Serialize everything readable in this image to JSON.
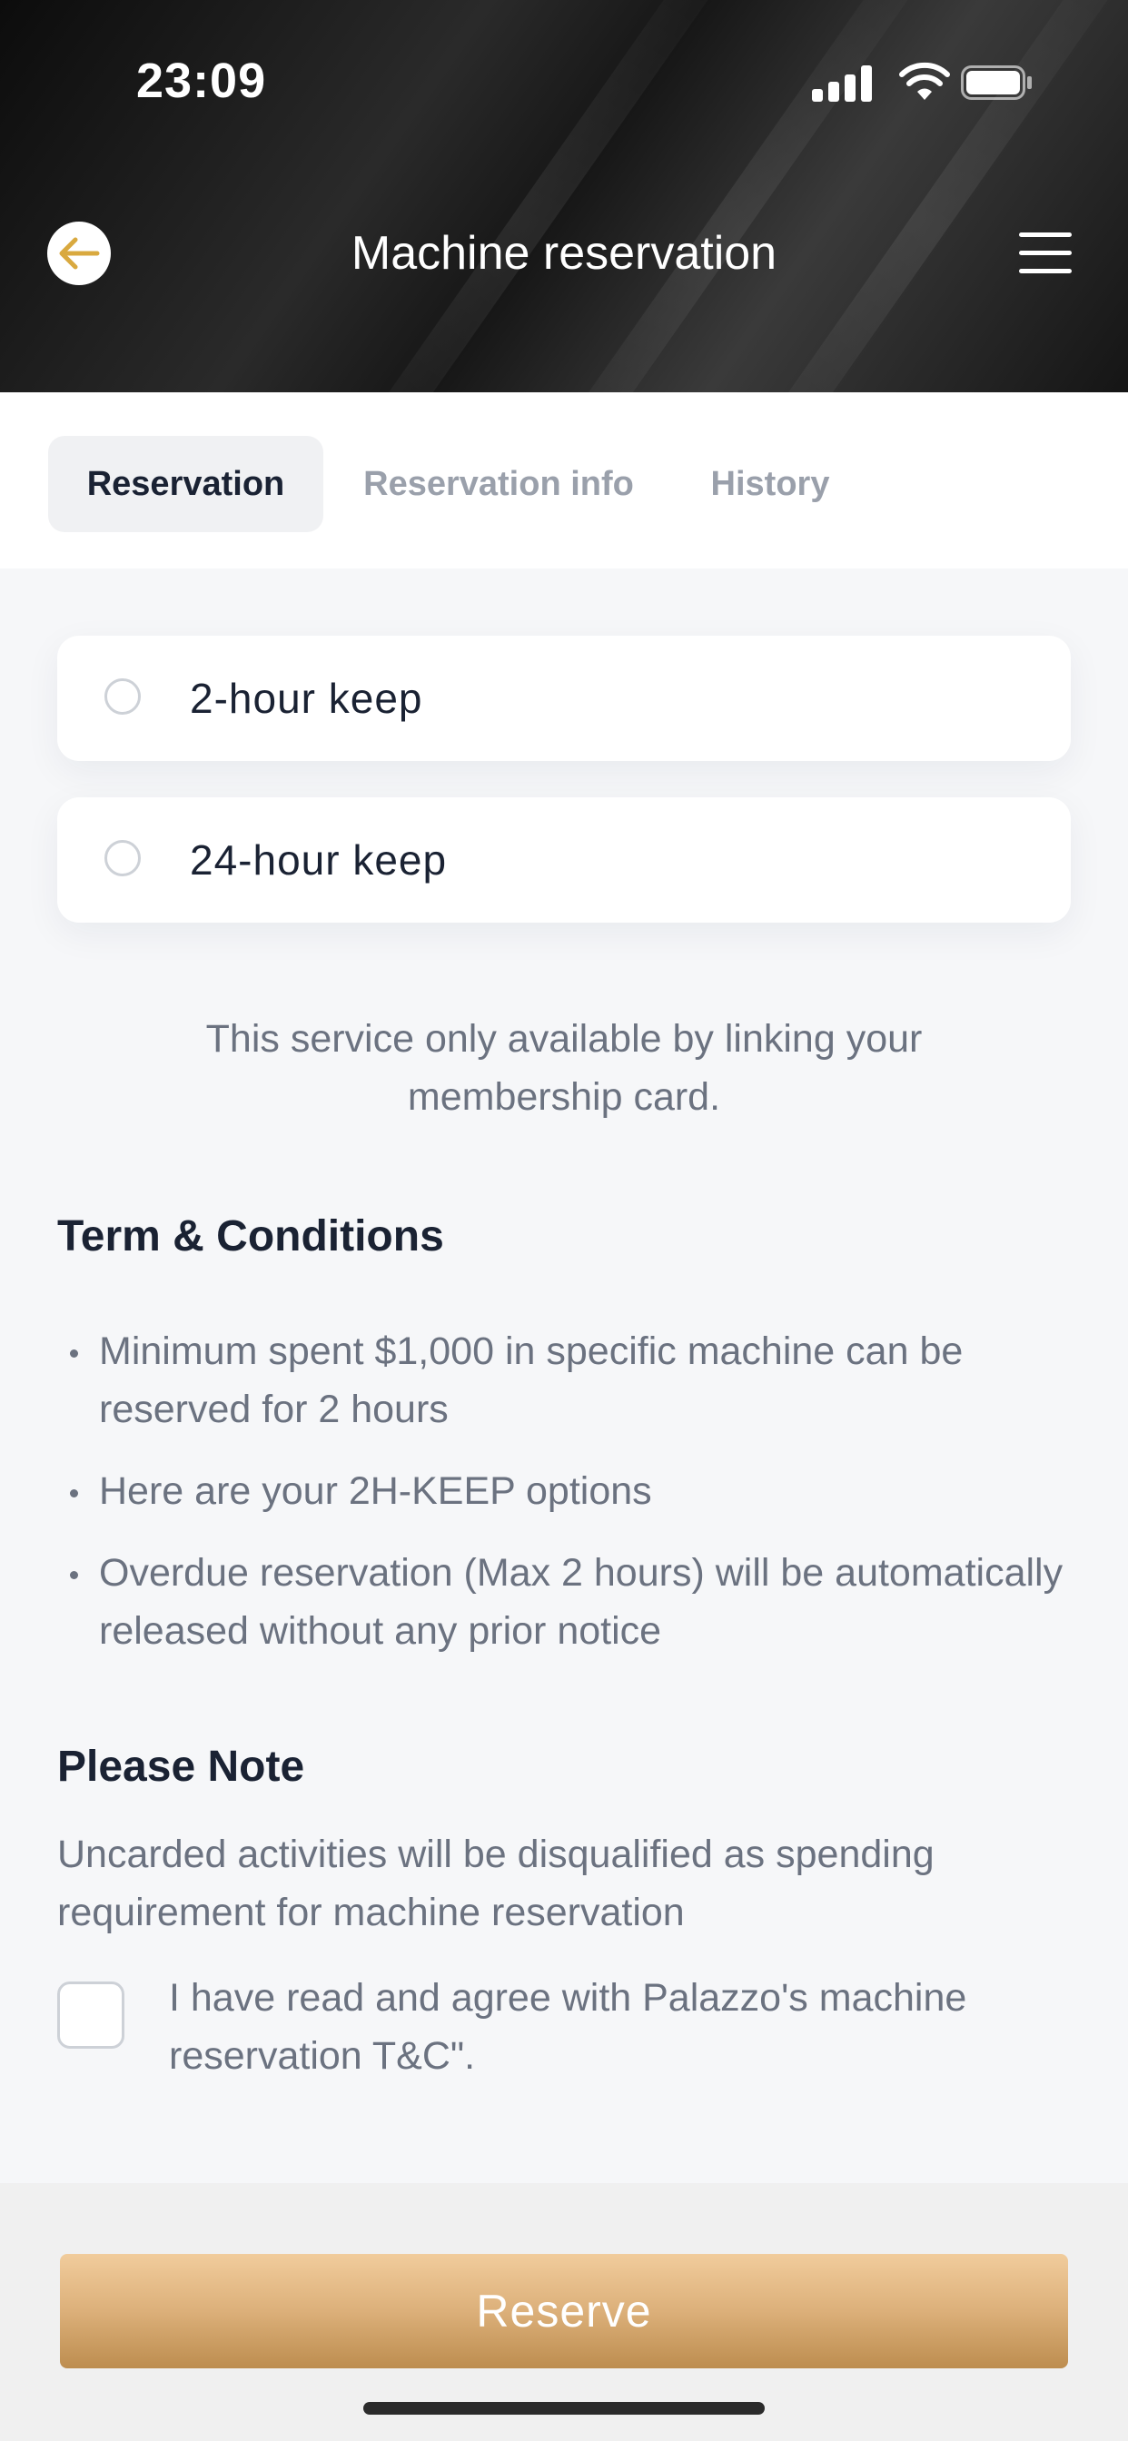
{
  "status_bar": {
    "time": "23:09"
  },
  "header": {
    "title": "Machine reservation",
    "back_icon": "arrow-left-icon",
    "menu_icon": "hamburger-menu-icon",
    "accent_color": "#d9a93f"
  },
  "tabs": [
    {
      "label": "Reservation",
      "active": true
    },
    {
      "label": "Reservation info",
      "active": false
    },
    {
      "label": "History",
      "active": false
    }
  ],
  "options": [
    {
      "label": "2-hour keep",
      "selected": false
    },
    {
      "label": "24-hour keep",
      "selected": false
    }
  ],
  "notice": "This service only available by linking your membership card.",
  "terms": {
    "heading": "Term & Conditions",
    "items": [
      "Minimum spent $1,000 in specific machine can be reserved for 2 hours",
      "Here are your 2H-KEEP options",
      "Overdue reservation (Max 2 hours) will be automatically released without any prior notice"
    ]
  },
  "please_note": {
    "heading": "Please Note",
    "text": "Uncarded activities will be disqualified as spending requirement for machine reservation"
  },
  "agreement": {
    "label": "I have read and agree with Palazzo's machine reservation T&C\".",
    "checked": false
  },
  "reserve_button": {
    "label": "Reserve",
    "gradient_top": "#f1cc9c",
    "gradient_bottom": "#bd8d4f"
  }
}
